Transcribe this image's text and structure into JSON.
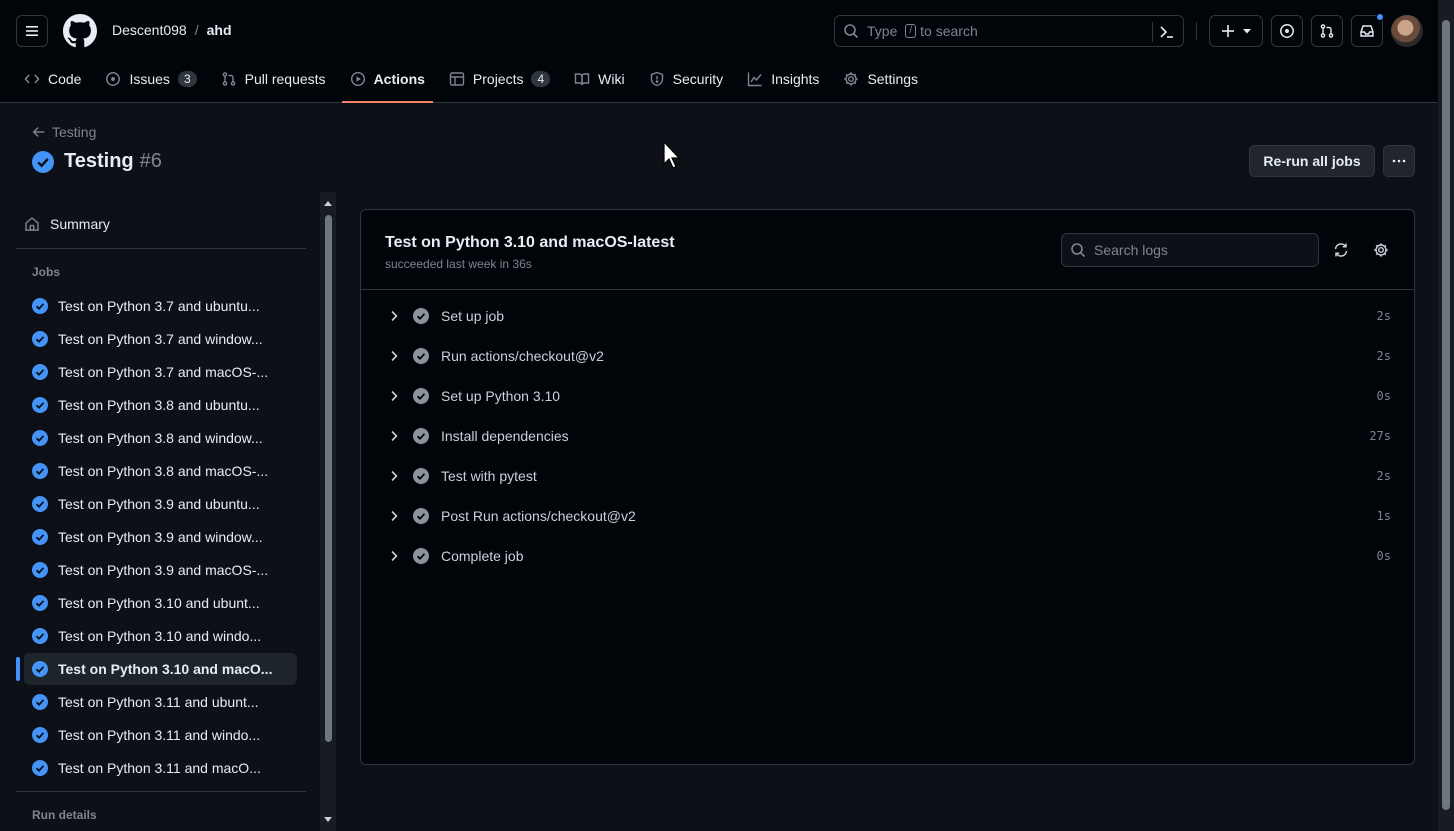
{
  "header": {
    "owner": "Descent098",
    "separator": "/",
    "repo": "ahd",
    "search_placeholder_pre": "Type",
    "search_key": "/",
    "search_placeholder_post": "to search"
  },
  "tabs": [
    {
      "label": "Code",
      "icon": "code-icon"
    },
    {
      "label": "Issues",
      "icon": "issue-icon",
      "count": "3"
    },
    {
      "label": "Pull requests",
      "icon": "pull-request-icon"
    },
    {
      "label": "Actions",
      "icon": "play-icon",
      "active": true
    },
    {
      "label": "Projects",
      "icon": "table-icon",
      "count": "4"
    },
    {
      "label": "Wiki",
      "icon": "book-icon"
    },
    {
      "label": "Security",
      "icon": "shield-icon"
    },
    {
      "label": "Insights",
      "icon": "graph-icon"
    },
    {
      "label": "Settings",
      "icon": "gear-icon"
    }
  ],
  "run": {
    "back_label": "Testing",
    "title": "Testing",
    "number": "#6",
    "rerun_label": "Re-run all jobs"
  },
  "sidebar": {
    "summary_label": "Summary",
    "jobs_heading": "Jobs",
    "jobs": [
      "Test on Python 3.7 and ubuntu...",
      "Test on Python 3.7 and window...",
      "Test on Python 3.7 and macOS-...",
      "Test on Python 3.8 and ubuntu...",
      "Test on Python 3.8 and window...",
      "Test on Python 3.8 and macOS-...",
      "Test on Python 3.9 and ubuntu...",
      "Test on Python 3.9 and window...",
      "Test on Python 3.9 and macOS-...",
      "Test on Python 3.10 and ubunt...",
      "Test on Python 3.10 and windo...",
      "Test on Python 3.10 and macO...",
      "Test on Python 3.11 and ubunt...",
      "Test on Python 3.11 and windo...",
      "Test on Python 3.11 and macO..."
    ],
    "selected_job_index": 11,
    "run_details_heading": "Run details"
  },
  "job": {
    "title": "Test on Python 3.10 and macOS-latest",
    "subtitle": "succeeded last week in 36s",
    "search_placeholder": "Search logs",
    "steps": [
      {
        "name": "Set up job",
        "duration": "2s"
      },
      {
        "name": "Run actions/checkout@v2",
        "duration": "2s"
      },
      {
        "name": "Set up Python 3.10",
        "duration": "0s"
      },
      {
        "name": "Install dependencies",
        "duration": "27s"
      },
      {
        "name": "Test with pytest",
        "duration": "2s"
      },
      {
        "name": "Post Run actions/checkout@v2",
        "duration": "1s"
      },
      {
        "name": "Complete job",
        "duration": "0s"
      }
    ]
  },
  "colors": {
    "success": "#4493f8",
    "step_check": "#8b949e",
    "active_tab_underline": "#f78166"
  }
}
